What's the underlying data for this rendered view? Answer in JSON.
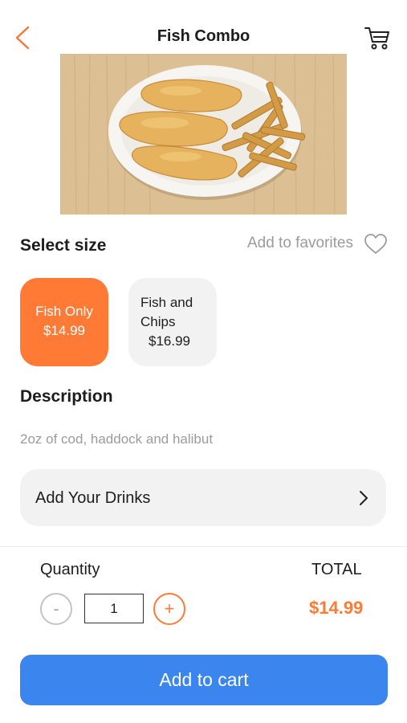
{
  "header": {
    "title": "Fish Combo",
    "back_icon": "chevron-left-icon",
    "cart_icon": "cart-icon"
  },
  "product": {
    "image": "fish-and-chips-photo"
  },
  "size_section": {
    "title": "Select size",
    "favorites_label": "Add to favorites",
    "favorites_icon": "heart-outline-icon",
    "options": [
      {
        "name": "Fish Only",
        "price": "$14.99",
        "selected": true
      },
      {
        "name": "Fish and Chips",
        "price": "$16.99",
        "selected": false
      }
    ]
  },
  "description": {
    "title": "Description",
    "text": "2oz of cod, haddock and halibut"
  },
  "drinks": {
    "label": "Add Your Drinks",
    "icon": "chevron-right-icon"
  },
  "order": {
    "quantity_label": "Quantity",
    "quantity_value": "1",
    "minus_symbol": "-",
    "plus_symbol": "+",
    "total_label": "TOTAL",
    "total_value": "$14.99"
  },
  "add_to_cart_label": "Add to cart",
  "colors": {
    "accent": "#ff7a35",
    "primary_button": "#3b86ee",
    "card_bg": "#f2f2f2",
    "muted_text": "#9b9b9b"
  }
}
